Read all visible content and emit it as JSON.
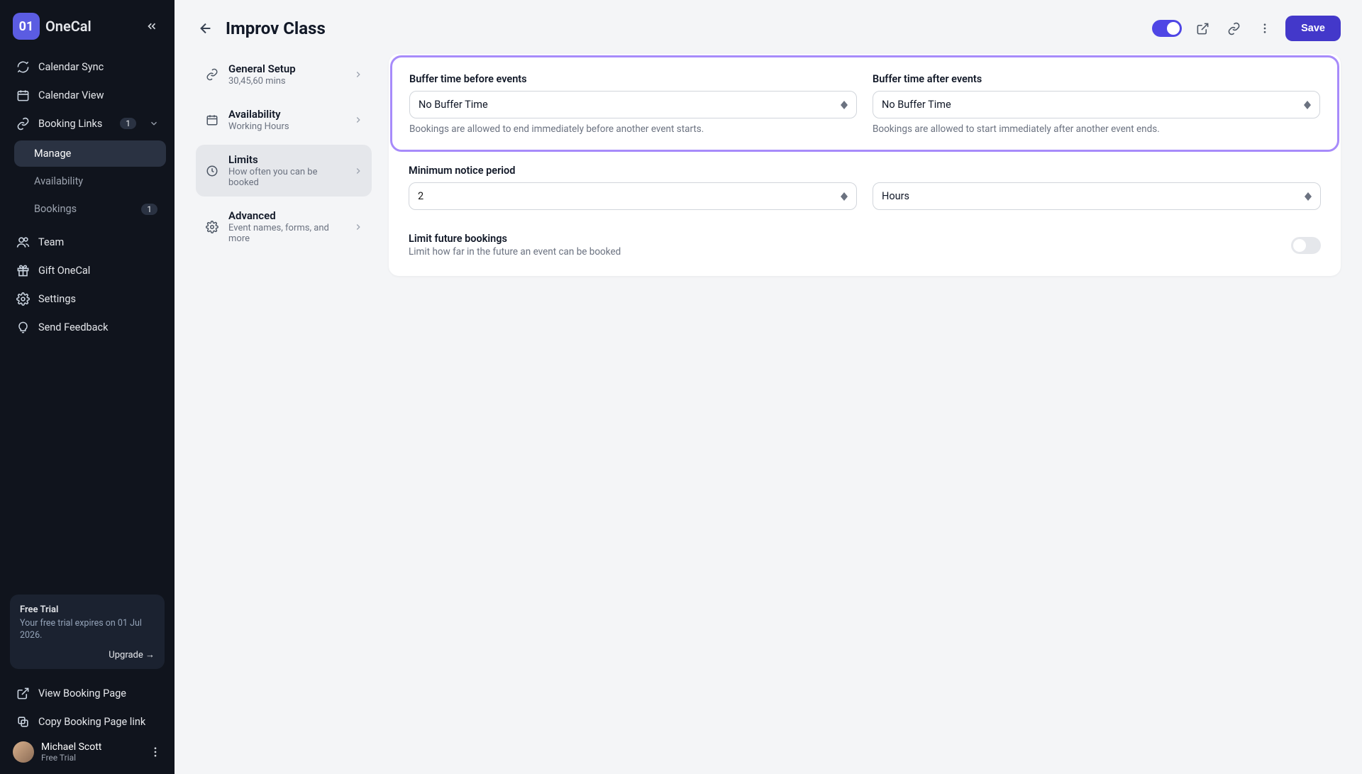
{
  "brand": {
    "mark": "01",
    "name": "OneCal"
  },
  "sidebar": {
    "items": {
      "calendar_sync": "Calendar Sync",
      "calendar_view": "Calendar View",
      "booking_links": {
        "label": "Booking Links",
        "badge": "1"
      },
      "team": "Team",
      "gift": "Gift OneCal",
      "settings": "Settings",
      "feedback": "Send Feedback"
    },
    "sub": {
      "manage": "Manage",
      "availability": "Availability",
      "bookings": {
        "label": "Bookings",
        "badge": "1"
      }
    },
    "trial": {
      "title": "Free Trial",
      "body": "Your free trial expires on 01 Jul 2026.",
      "upgrade": "Upgrade →"
    },
    "bottom": {
      "view_page": "View Booking Page",
      "copy_link": "Copy Booking Page link"
    },
    "user": {
      "name": "Michael Scott",
      "plan": "Free Trial"
    }
  },
  "header": {
    "title": "Improv Class",
    "save": "Save"
  },
  "tabs": {
    "general": {
      "title": "General Setup",
      "sub": "30,45,60 mins"
    },
    "availability": {
      "title": "Availability",
      "sub": "Working Hours"
    },
    "limits": {
      "title": "Limits",
      "sub": "How often you can be booked"
    },
    "advanced": {
      "title": "Advanced",
      "sub": "Event names, forms, and more"
    }
  },
  "panel": {
    "buffer_before": {
      "label": "Buffer time before events",
      "value": "No Buffer Time",
      "helper": "Bookings are allowed to end immediately before another event starts."
    },
    "buffer_after": {
      "label": "Buffer time after events",
      "value": "No Buffer Time",
      "helper": "Bookings are allowed to start immediately after another event ends."
    },
    "min_notice": {
      "label": "Minimum notice period",
      "value": "2",
      "unit": "Hours"
    },
    "limit_future": {
      "title": "Limit future bookings",
      "sub": "Limit how far in the future an event can be booked"
    }
  }
}
